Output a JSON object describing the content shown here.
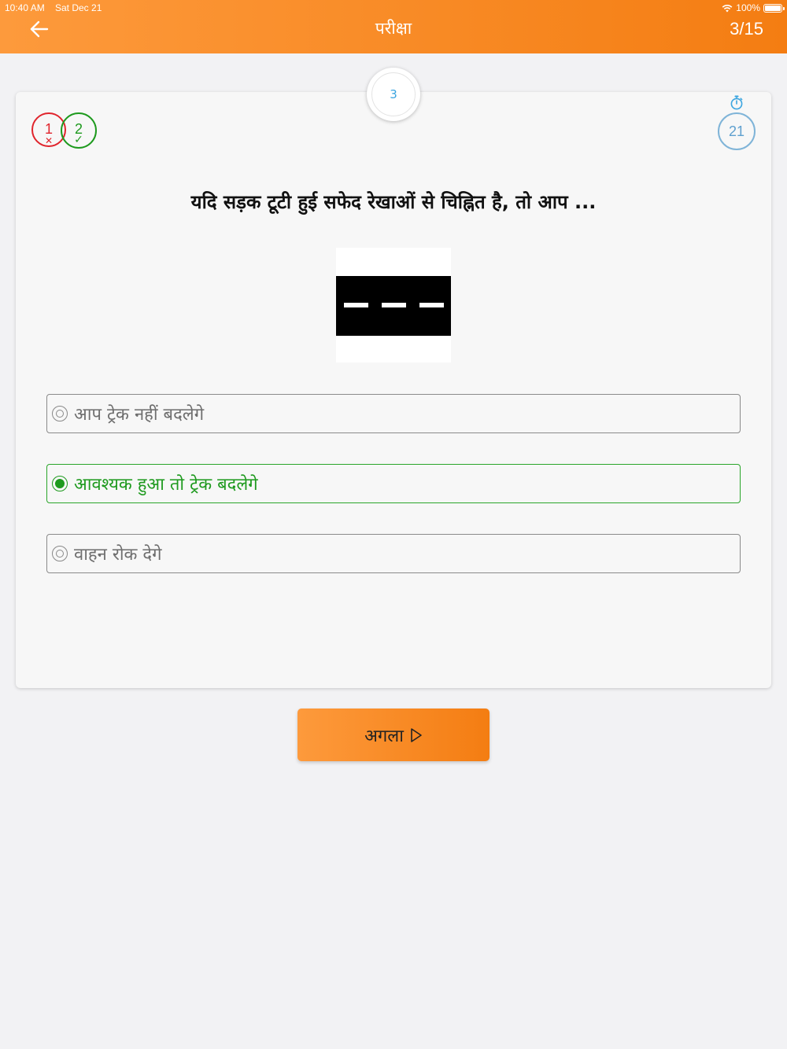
{
  "status_bar": {
    "time": "10:40 AM",
    "date": "Sat Dec 21",
    "battery": "100%"
  },
  "header": {
    "title": "परीक्षा",
    "progress": "3/15"
  },
  "question": {
    "number": "3",
    "text": "यदि सड़क टूटी हुई सफेद रेखाओं से चिह्नित है, तो आप ...",
    "image": "road-broken-white-lines"
  },
  "score": {
    "wrong": "1",
    "right": "2"
  },
  "timer": {
    "seconds": "21"
  },
  "options": [
    {
      "label": "आप ट्रेक नहीं बदलेगे",
      "selected": false
    },
    {
      "label": "आवश्यक हुआ तो ट्रेक  बदलेगे",
      "selected": true
    },
    {
      "label": "वाहन रोक देगे",
      "selected": false
    }
  ],
  "next_button": {
    "label": "अगला"
  },
  "colors": {
    "accent_start": "#fd9a3c",
    "accent_end": "#f47d12",
    "wrong": "#e0242c",
    "right": "#1e9a1e",
    "timer": "#7fb4d8"
  }
}
